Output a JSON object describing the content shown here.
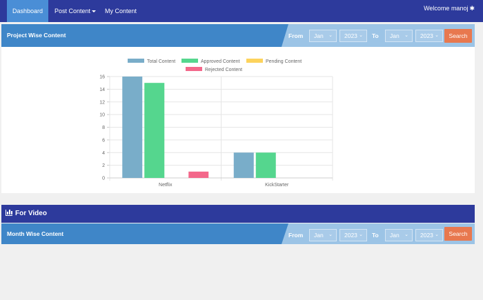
{
  "nav": {
    "dashboard": "Dashboard",
    "post_content": "Post Content",
    "my_content": "My Content",
    "welcome": "Welcome manoj"
  },
  "project_section": {
    "title": "Project Wise Content",
    "from_label": "From",
    "to_label": "To",
    "from_month": "Jan",
    "from_year": "2023",
    "to_month": "Jan",
    "to_year": "2023",
    "search_label": "Search"
  },
  "video_section": {
    "title": "For Video"
  },
  "month_section": {
    "title": "Month Wise Content",
    "from_label": "From",
    "to_label": "To",
    "from_month": "Jan",
    "from_year": "2023",
    "to_month": "Jan",
    "to_year": "2023",
    "search_label": "Search"
  },
  "colors": {
    "navbar": "#2d3a9c",
    "header": "#3f86c8",
    "search": "#e8784f"
  },
  "chart_data": {
    "type": "bar",
    "categories": [
      "Netflix",
      "KickStarter"
    ],
    "series": [
      {
        "name": "Total Content",
        "values": [
          16,
          4
        ],
        "color": "#79adc9"
      },
      {
        "name": "Approved Content",
        "values": [
          15,
          4
        ],
        "color": "#55d68e"
      },
      {
        "name": "Pending Content",
        "values": [
          0,
          0
        ],
        "color": "#fdd35c"
      },
      {
        "name": "Rejected Content",
        "values": [
          1,
          0
        ],
        "color": "#f3678a"
      }
    ],
    "yticks": [
      "0",
      "2",
      "4",
      "6",
      "8",
      "10",
      "12",
      "14",
      "16"
    ],
    "ylim": [
      0,
      16
    ],
    "grid": true,
    "legend_position": "top"
  }
}
